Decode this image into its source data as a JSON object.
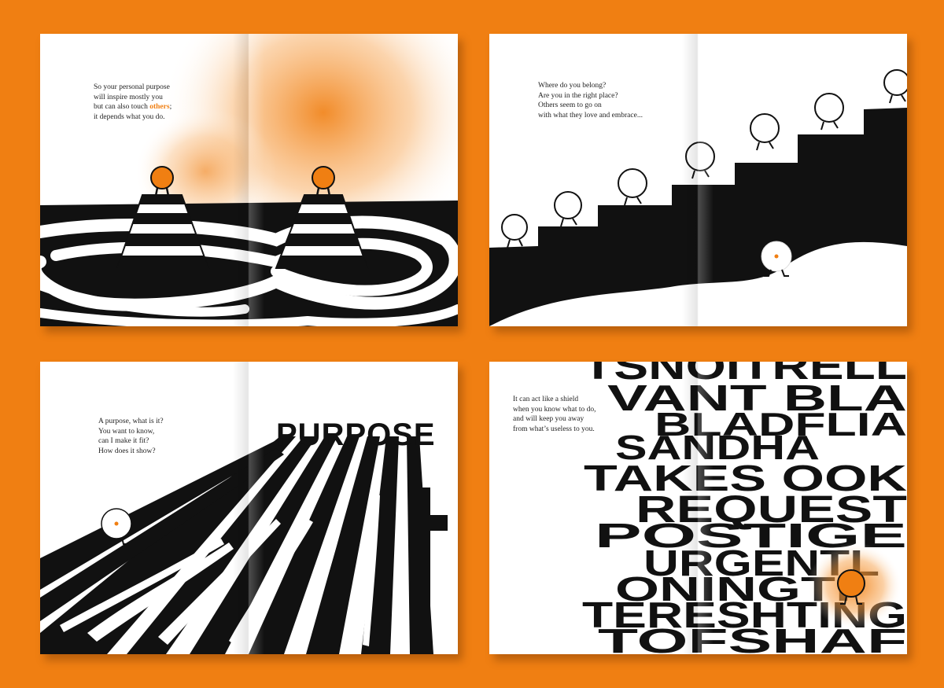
{
  "spreads": [
    {
      "lines": [
        "So your personal purpose",
        "will inspire mostly you",
        "but can also touch",
        "others",
        ";",
        "it depends what you do."
      ]
    },
    {
      "lines": [
        "Where do you belong?",
        "Are you in the right place?",
        "Others seem to go on",
        "with what they love and embrace..."
      ]
    },
    {
      "lines": [
        "A purpose, what is it?",
        "You want to know,",
        "can I make it fit?",
        "How does it show?"
      ],
      "headline": "PURPOSE"
    },
    {
      "lines": [
        "It can act like a shield",
        "when you know what to do,",
        "and will keep you away",
        "from what’s useless to you."
      ],
      "word_rows": [
        "TSNOITRELL",
        "VANT BLA",
        "BLADFLIA",
        "SANDHA",
        "TAKES OOK",
        "REQUEST",
        "POSTIGE",
        "URGENTL",
        "ONINGTI",
        "TERESHTING",
        "TOFSHAF"
      ]
    }
  ],
  "colors": {
    "background": "#f07f12",
    "accent": "#f07f12",
    "ink": "#111111",
    "paper": "#ffffff"
  }
}
